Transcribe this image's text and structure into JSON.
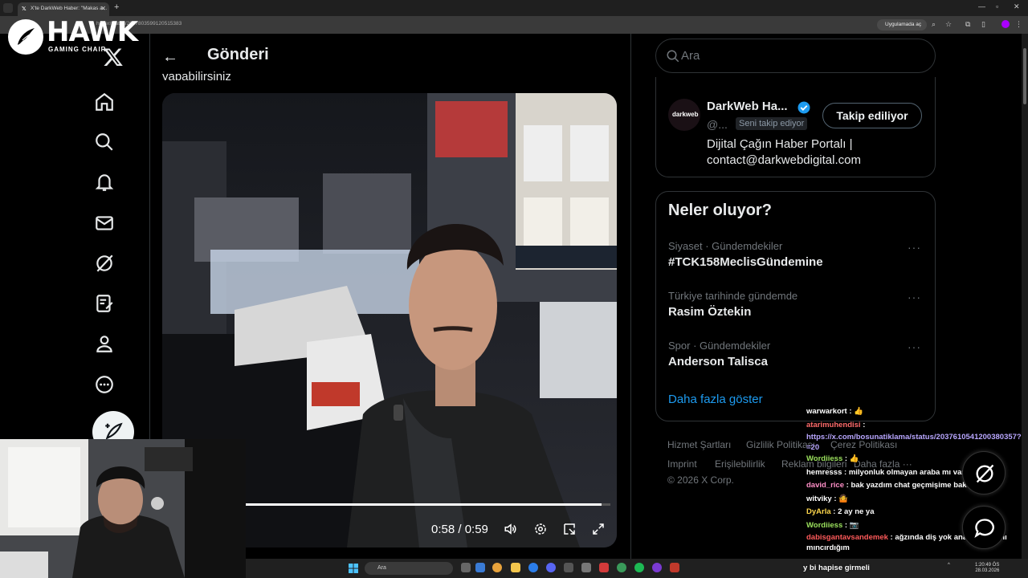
{
  "browser": {
    "tab_title": "X'te DarkWeb Haber: \"Makas a...",
    "url": "haber/status/2037803599120515383",
    "open_app_label": "Uygulamada aç"
  },
  "overlay": {
    "brand_name": "HAWK",
    "brand_sub": "GAMING CHAIR"
  },
  "post": {
    "header_title": "Gönderi",
    "text_fragment": "yapabilirsiniz",
    "video": {
      "time_display": "0:58 / 0:59",
      "progress": 0.98
    }
  },
  "search": {
    "placeholder": "Ara"
  },
  "profile": {
    "name": "DarkWeb Ha...",
    "handle": "@...",
    "follows_you": "Seni takip ediyor",
    "follow_button": "Takip ediliyor",
    "bio_line1": "Dijital Çağın Haber Portalı |",
    "bio_line2": "contact@darkwebdigital.com",
    "avatar_text": "darkweb"
  },
  "trends": {
    "title": "Neler oluyor?",
    "items": [
      {
        "meta": "Siyaset · Gündemdekiler",
        "name": "#TCK158MeclisGündemine"
      },
      {
        "meta": "Türkiye tarihinde gündemde",
        "name": "Rasim Öztekin"
      },
      {
        "meta": "Spor · Gündemdekiler",
        "name": "Anderson Talisca"
      }
    ],
    "more_icon": "···",
    "show_more": "Daha fazla göster"
  },
  "footer": {
    "links": [
      "Hizmet Şartları",
      "Gizlilik Politikası",
      "Çerez Politikası",
      "Imprint",
      "Erişilebilirlik",
      "Reklam bilgileri",
      "Daha fazla ···"
    ],
    "copyright": "© 2026 X Corp."
  },
  "chat": {
    "messages": [
      {
        "user": "warwarkort",
        "text": " : 👍"
      },
      {
        "user": "atarimuhendisi",
        "text": " :"
      },
      {
        "user": "",
        "text": "https://x.com/bosunatiklama/status/2037610541200380357?s=20"
      },
      {
        "user": "Wordiiess",
        "text": " : 👍"
      },
      {
        "user": "hemresss",
        "text": " : milyonluk olmayan araba mı var got"
      },
      {
        "user": "david_rice",
        "text": " : bak yazdım chat geçmişime bak @Cavs"
      },
      {
        "user": "witviky",
        "text": " : 🤷"
      },
      {
        "user": "DyArla",
        "text": " : 2 ay ne ya"
      },
      {
        "user": "Wordiiess",
        "text": " : 📷"
      },
      {
        "user": "dabisgantavsandemek",
        "text": " : ağzında diş yok anasının amını mıncırdığım"
      }
    ],
    "last_line": "y bi hapise girmeli"
  },
  "taskbar": {
    "search_placeholder": "Ara",
    "clock_time": "1:20:49 ÖS",
    "clock_date": "28.03.2026"
  },
  "colors": {
    "accent": "#1d9bf0",
    "background": "#000000",
    "border": "#2f3336",
    "muted": "#71767b"
  }
}
